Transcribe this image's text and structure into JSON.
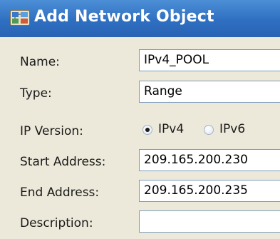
{
  "dialog": {
    "title": "Add Network Object",
    "icon": "network-object-icon"
  },
  "form": {
    "name_label": "Name:",
    "name_value": "IPv4_POOL",
    "type_label": "Type:",
    "type_value": "Range",
    "ip_version_label": "IP Version:",
    "ip_version_options": [
      "IPv4",
      "IPv6"
    ],
    "ip_version_selected": "IPv4",
    "start_label": "Start Address:",
    "start_value": "209.165.200.230",
    "end_label": "End Address:",
    "end_value": "209.165.200.235",
    "description_label": "Description:",
    "description_value": ""
  },
  "colors": {
    "titlebar": "#2f6fc1",
    "title_text": "#ffffff",
    "panel_bg": "#ede9da",
    "field_border": "#7f9db9"
  }
}
